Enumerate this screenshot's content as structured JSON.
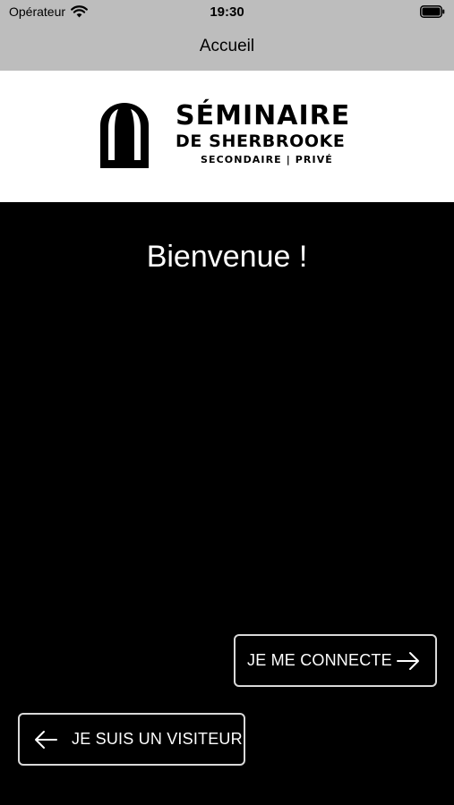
{
  "status_bar": {
    "carrier": "Opérateur",
    "time": "19:30"
  },
  "nav": {
    "title": "Accueil"
  },
  "logo": {
    "line1": "SÉMINAIRE",
    "line2": "DE SHERBROOKE",
    "line3": "SECONDAIRE | PRIVÉ"
  },
  "main": {
    "welcome": "Bienvenue !"
  },
  "buttons": {
    "connect_label": "JE ME CONNECTE",
    "visitor_label": "JE SUIS UN VISITEUR"
  },
  "icons": {
    "wifi": "wifi-icon",
    "battery": "battery-icon",
    "logo_mark": "arch-logo-icon",
    "arrow_right": "arrow-right-icon",
    "arrow_left": "arrow-left-icon"
  },
  "colors": {
    "topbar": "#bdbdbd",
    "background": "#000000",
    "logo_band": "#ffffff",
    "button_border": "#d9d9d9"
  }
}
